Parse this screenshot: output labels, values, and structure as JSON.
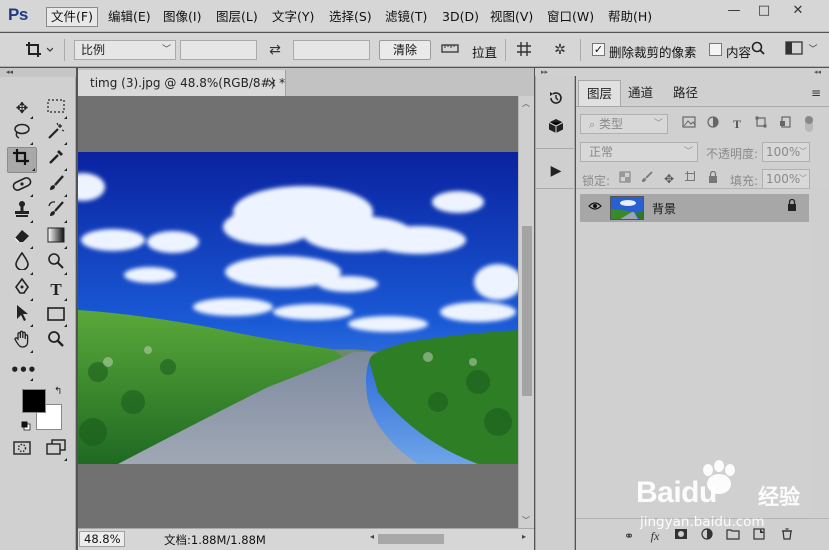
{
  "app": {
    "logo": "Ps"
  },
  "menu": {
    "items": [
      {
        "label": "文件(F)"
      },
      {
        "label": "编辑(E)"
      },
      {
        "label": "图像(I)"
      },
      {
        "label": "图层(L)"
      },
      {
        "label": "文字(Y)"
      },
      {
        "label": "选择(S)"
      },
      {
        "label": "滤镜(T)"
      },
      {
        "label": "3D(D)"
      },
      {
        "label": "视图(V)"
      },
      {
        "label": "窗口(W)"
      },
      {
        "label": "帮助(H)"
      }
    ]
  },
  "window_controls": {
    "minimize": "—",
    "maximize": "□",
    "close": "✕"
  },
  "options": {
    "ratio_value": "比例",
    "clear_label": "清除",
    "straighten_label": "拉直",
    "delete_cropped_label": "删除裁剪的像素",
    "delete_cropped_checked": true,
    "content_aware_label": "内容",
    "content_aware_checked": false,
    "swap_icon": "swap-icon",
    "settings_icon": "gear-icon"
  },
  "document": {
    "tab_title": "timg (3).jpg @ 48.8%(RGB/8#) *",
    "close": "×"
  },
  "status": {
    "zoom": "48.8%",
    "doc_size": "文档:1.88M/1.88M"
  },
  "colors": {
    "foreground": "#000000",
    "background": "#ffffff",
    "sky_top": "#0a2fa8",
    "sky_bottom": "#5a9be8",
    "grass": "#2f8a2a",
    "road": "#8e98a8"
  },
  "layers_panel": {
    "tabs": [
      {
        "label": "图层"
      },
      {
        "label": "通道"
      },
      {
        "label": "路径"
      }
    ],
    "filter_kind": "类型",
    "blend_mode": "正常",
    "opacity_label": "不透明度:",
    "opacity_value": "100%",
    "lock_label": "锁定:",
    "fill_label": "填充:",
    "fill_value": "100%",
    "layers": [
      {
        "name": "背景",
        "visible": true,
        "locked": true
      }
    ]
  },
  "watermark": {
    "logo": "Baidu",
    "cn": "经验",
    "url": "jingyan.baidu.com"
  }
}
